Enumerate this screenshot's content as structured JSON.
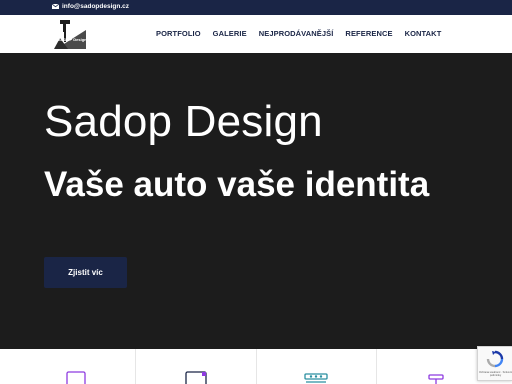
{
  "topbar": {
    "email": "info@sadopdesign.cz",
    "mail_icon": "envelope-icon"
  },
  "logo": {
    "alt_text": "SADOP Design"
  },
  "nav": {
    "items": [
      {
        "label": "PORTFOLIO"
      },
      {
        "label": "GALERIE"
      },
      {
        "label": "NEJPRODÁVANĚJŠÍ"
      },
      {
        "label": "REFERENCE"
      },
      {
        "label": "KONTAKT"
      }
    ]
  },
  "hero": {
    "title": "Sadop Design",
    "subtitle": "Vaše auto vaše identita",
    "button_label": "Zjistit víc"
  },
  "cards": {
    "icons": [
      "monitor-icon",
      "display-icon",
      "car-wash-icon",
      "paint-roller-icon"
    ]
  },
  "recaptcha": {
    "text": "Ochrana soukromí · Smluvní podmínky"
  },
  "colors": {
    "navy": "#1a2546",
    "hero_bg": "#1c1c1c",
    "accent_purple": "#8e3be0",
    "accent_teal": "#2a8fa0"
  }
}
